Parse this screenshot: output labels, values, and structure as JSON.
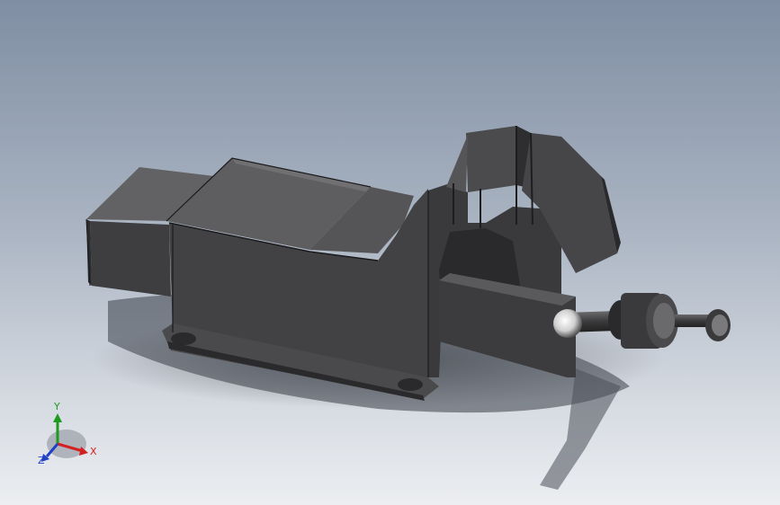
{
  "viewport": {
    "background_top": "#7f8ea3",
    "background_bottom": "#eceef1",
    "model_color": "#3d3d3f"
  },
  "triad": {
    "x_label": "X",
    "y_label": "Y",
    "z_label": "Z",
    "x_color": "#d32020",
    "y_color": "#1e9a1e",
    "z_color": "#2040c8"
  }
}
